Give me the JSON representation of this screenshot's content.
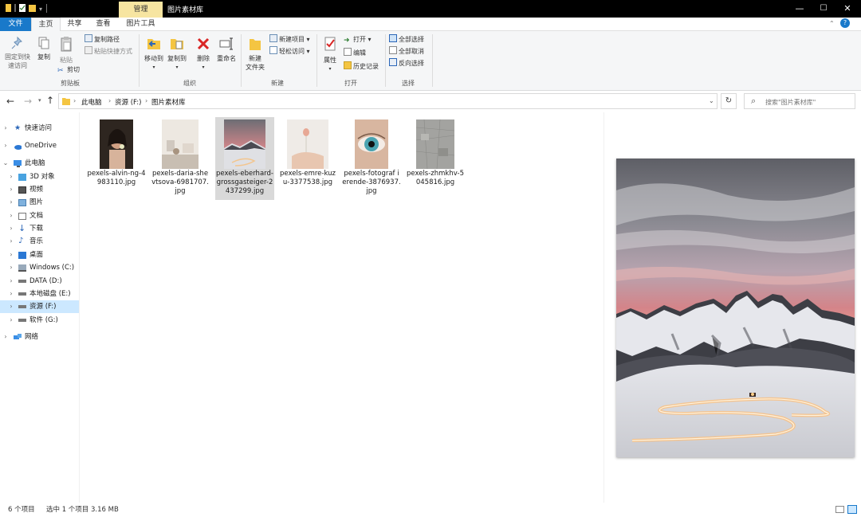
{
  "window": {
    "context_tab": "管理",
    "title": "图片素材库",
    "minimize": "—",
    "maximize": "☐",
    "close": "✕"
  },
  "tabs": [
    {
      "label": "文件"
    },
    {
      "label": "主页"
    },
    {
      "label": "共享"
    },
    {
      "label": "查看"
    },
    {
      "label": "图片工具"
    }
  ],
  "ribbon": {
    "pin": "固定到快\n速访问",
    "copy": "复制",
    "paste": "粘贴",
    "copy_path": "复制路径",
    "paste_shortcut": "粘贴快捷方式",
    "cut": "剪切",
    "group_clipboard": "剪贴板",
    "move_to": "移动到",
    "copy_to": "复制到",
    "delete": "删除",
    "rename": "重命名",
    "group_organize": "组织",
    "new_folder": "新建\n文件夹",
    "new_item": "新建项目",
    "easy_access": "轻松访问",
    "group_new": "新建",
    "properties": "属性",
    "open": "打开",
    "edit": "编辑",
    "history": "历史记录",
    "group_open": "打开",
    "select_all": "全部选择",
    "select_none": "全部取消",
    "invert": "反向选择",
    "group_select": "选择"
  },
  "address": {
    "crumbs": [
      "此电脑",
      "资源 (F:)",
      "图片素材库"
    ],
    "search_placeholder": "搜索\"图片素材库\""
  },
  "nav": [
    {
      "label": "快速访问"
    },
    {
      "label": "OneDrive"
    },
    {
      "label": "此电脑"
    },
    {
      "label": "3D 对象"
    },
    {
      "label": "视频"
    },
    {
      "label": "图片"
    },
    {
      "label": "文档"
    },
    {
      "label": "下载"
    },
    {
      "label": "音乐"
    },
    {
      "label": "桌面"
    },
    {
      "label": "Windows (C:)"
    },
    {
      "label": "DATA (D:)"
    },
    {
      "label": "本地磁盘 (E:)"
    },
    {
      "label": "资源 (F:)"
    },
    {
      "label": "软件 (G:)"
    },
    {
      "label": "网络"
    }
  ],
  "files": [
    {
      "name": "pexels-alvin-ng-4983110.jpg",
      "selected": false
    },
    {
      "name": "pexels-daria-shevtsova-6981707.jpg",
      "selected": false
    },
    {
      "name": "pexels-eberhard-grossgasteiger-2437299.jpg",
      "selected": true
    },
    {
      "name": "pexels-emre-kuzu-3377538.jpg",
      "selected": false
    },
    {
      "name": "pexels-fotograf ierende-3876937.jpg",
      "selected": false
    },
    {
      "name": "pexels-zhmkhv-5045816.jpg",
      "selected": false
    }
  ],
  "status": {
    "count": "6 个项目",
    "selection": "选中 1 个项目  3.16 MB"
  },
  "colors": {
    "file_tab": "#1979ca",
    "context_tab": "#f7e5a1",
    "selection": "#cce8ff"
  }
}
